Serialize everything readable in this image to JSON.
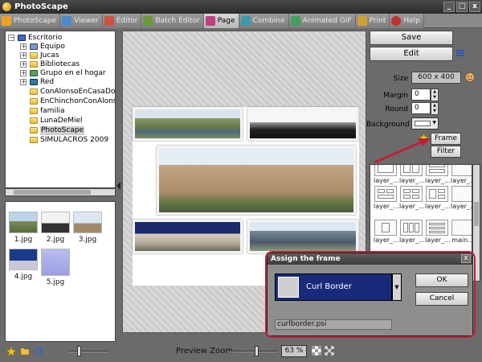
{
  "app": {
    "title": "PhotoScape",
    "min": "_",
    "max": "□",
    "close": "x"
  },
  "tabs": [
    {
      "label": "PhotoScape",
      "color": "#f0a020"
    },
    {
      "label": "Viewer",
      "color": "#4a8ad0"
    },
    {
      "label": "Editor",
      "color": "#d05040"
    },
    {
      "label": "Batch Editor",
      "color": "#6a9a3a"
    },
    {
      "label": "Page",
      "color": "#c04080"
    },
    {
      "label": "Combine",
      "color": "#3a9ab0"
    },
    {
      "label": "Animated GIF",
      "color": "#40a060"
    },
    {
      "label": "Print",
      "color": "#d0a030"
    },
    {
      "label": "Help",
      "color": "#c03030"
    }
  ],
  "tree": {
    "root": "Escritorio",
    "children": [
      "Equipo",
      "Jucas",
      "Bibliotecas",
      "Grupo en el hogar",
      "Red"
    ],
    "folders": [
      "ConAlonsoEnCasaDom",
      "EnChinchonConAlonso",
      "familia",
      "LunaDeMiel",
      "PhotoScape",
      "SIMULACROS 2009"
    ]
  },
  "thumbnails": [
    "1.jpg",
    "2.jpg",
    "3.jpg",
    "4.jpg",
    "5.jpg"
  ],
  "zoom": {
    "label": "Preview Zoom",
    "value": "63 %"
  },
  "right": {
    "save": "Save",
    "edit": "Edit",
    "size_label": "Size",
    "size_value": "600 x 400",
    "margin_label": "Margin",
    "margin_value": "0",
    "round_label": "Round",
    "round_value": "0",
    "background_label": "Background",
    "frame": "Frame",
    "filter": "Filter",
    "frame_items": [
      "layer_...",
      "layer_...",
      "layer_...",
      "layer_...",
      "layer_...",
      "layer_...",
      "layer_...",
      "layer_...",
      "layer_...",
      "layer_...",
      "layer_...",
      "main..."
    ]
  },
  "dialog": {
    "title": "Assign the frame",
    "selected": "Curl Border",
    "ok": "OK",
    "cancel": "Cancel",
    "file": "curlborder.psi",
    "close": "x"
  },
  "colors": {
    "highlight": "#c0203a",
    "selection": "#1a2a7a",
    "accent": "#f0a020"
  }
}
